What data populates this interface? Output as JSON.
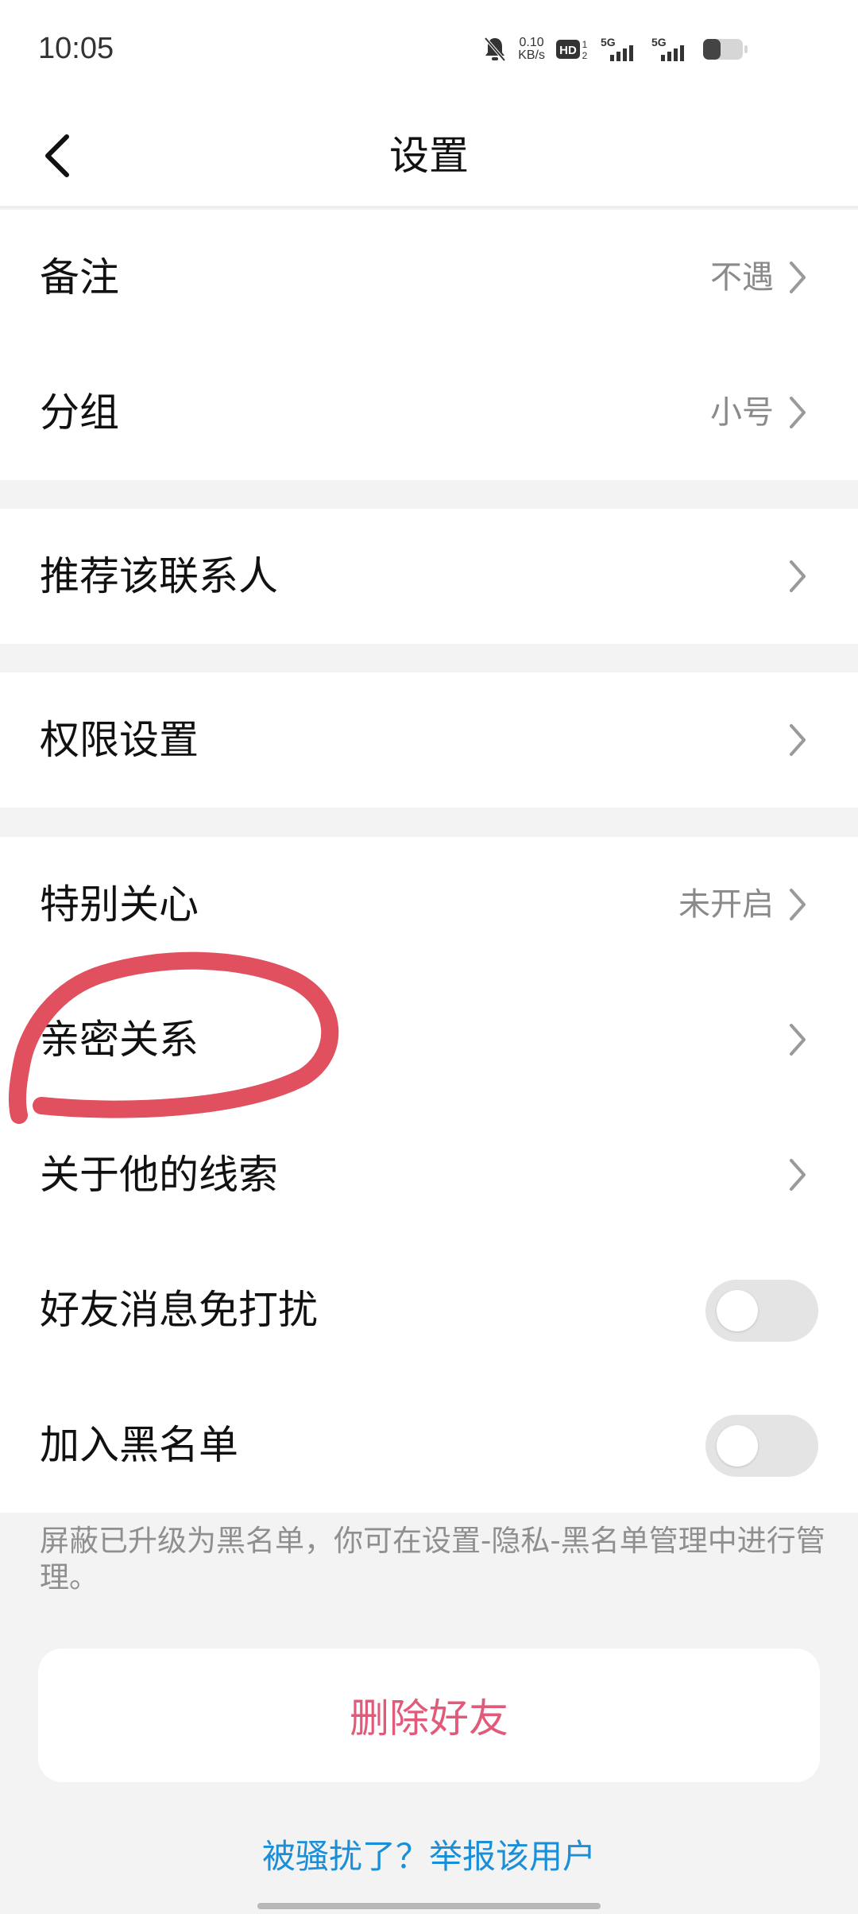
{
  "status_bar": {
    "time": "10:05",
    "net_speed_value": "0.10",
    "net_speed_unit": "KB/s",
    "hd_label": "HD",
    "network_1": "5G",
    "network_2": "5G"
  },
  "nav": {
    "title": "设置"
  },
  "rows": {
    "remark": {
      "label": "备注",
      "value": "不遇"
    },
    "group": {
      "label": "分组",
      "value": "小号"
    },
    "recommend": {
      "label": "推荐该联系人"
    },
    "permission": {
      "label": "权限设置"
    },
    "special_care": {
      "label": "特别关心",
      "value": "未开启"
    },
    "intimacy": {
      "label": "亲密关系"
    },
    "clues": {
      "label": "关于他的线索"
    },
    "do_not_disturb": {
      "label": "好友消息免打扰",
      "on": false
    },
    "blacklist": {
      "label": "加入黑名单",
      "on": false
    }
  },
  "hint": "屏蔽已升级为黑名单，你可在设置-隐私-黑名单管理中进行管理。",
  "delete_button": "删除好友",
  "report_link": "被骚扰了？举报该用户",
  "colors": {
    "delete": "#e05a7a",
    "link": "#1a8fd8",
    "annotation": "#e0505e"
  }
}
